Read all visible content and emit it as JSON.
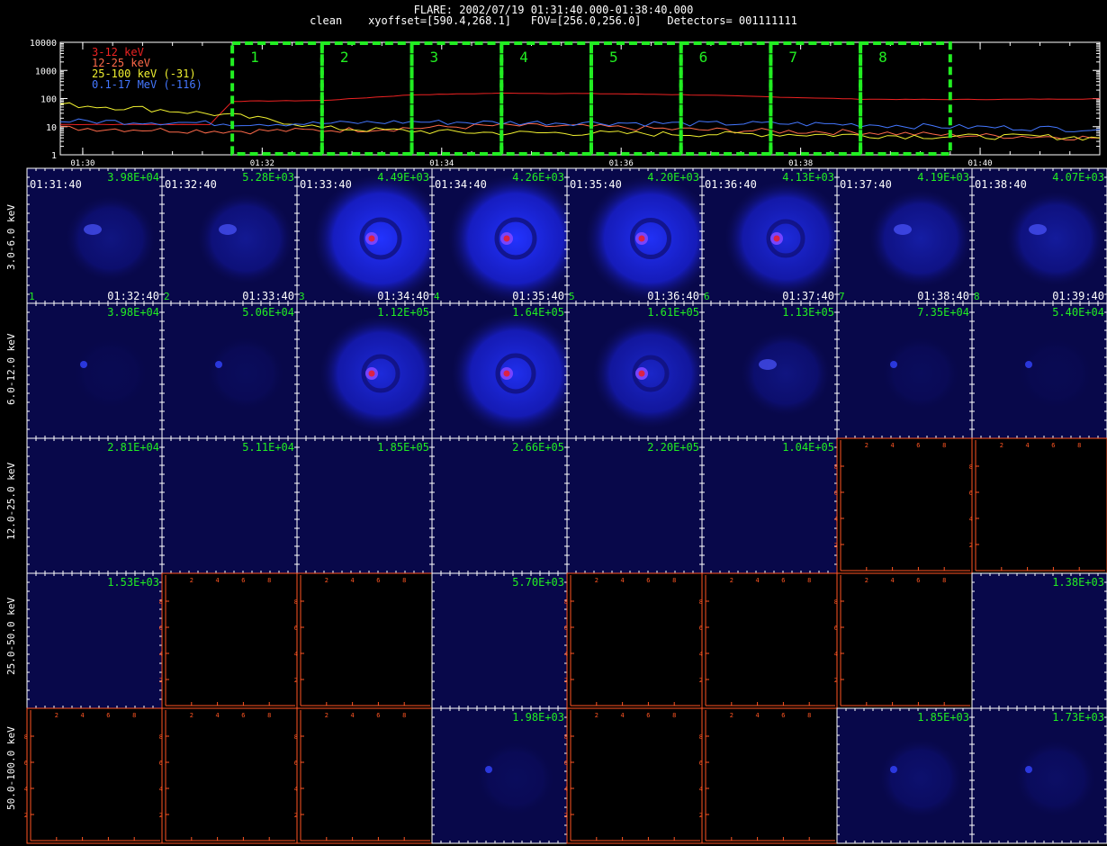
{
  "header": {
    "title": "FLARE: 2002/07/19 01:31:40.000-01:38:40.000",
    "subtitle": "clean    xyoffset=[590.4,268.1]   FOV=[256.0,256.0]    Detectors= 001111111"
  },
  "colors": {
    "background": "#000000",
    "frame": "#ffffff",
    "interval_box": "#22ee22",
    "peak_label": "#22ee22",
    "empty_axis": "#ff5522",
    "image_base": "#08084a"
  },
  "chart_data": [
    {
      "type": "line",
      "ylim": [
        1,
        10000
      ],
      "yscale": "log",
      "yticks": [
        "1",
        "10",
        "100",
        "1000",
        "10000"
      ],
      "xlim_minutes": [
        "01:29:45",
        "01:41:20"
      ],
      "xticks": [
        "01:30",
        "01:32",
        "01:34",
        "01:36",
        "01:38",
        "01:40"
      ],
      "series": [
        {
          "name": "3-12 keV",
          "color": "#ee2222",
          "x": [
            "01:29:45",
            "01:31:00",
            "01:31:25",
            "01:31:40",
            "01:32:40",
            "01:33:40",
            "01:34:40",
            "01:35:40",
            "01:36:40",
            "01:37:40",
            "01:38:40",
            "01:39:40",
            "01:40:40",
            "01:41:20"
          ],
          "values": [
            12,
            12,
            12,
            80,
            85,
            135,
            155,
            150,
            138,
            115,
            95,
            92,
            95,
            98
          ]
        },
        {
          "name": "12-25 keV",
          "color": "#ff6a4a",
          "x": [
            "01:29:45",
            "01:30:40",
            "01:31:40",
            "01:32:40",
            "01:33:40",
            "01:34:40",
            "01:35:40",
            "01:36:40",
            "01:37:40",
            "01:38:40",
            "01:39:40",
            "01:40:40",
            "01:41:20"
          ],
          "values": [
            9,
            8,
            7,
            7.5,
            9,
            11,
            10,
            8,
            7,
            6.5,
            5,
            4.5,
            4
          ]
        },
        {
          "name": "25-100 keV (-31)",
          "color": "#f0f030",
          "x": [
            "01:29:45",
            "01:30:40",
            "01:31:40",
            "01:32:20",
            "01:32:40",
            "01:33:40",
            "01:34:40",
            "01:35:40",
            "01:36:40",
            "01:37:40",
            "01:38:40",
            "01:39:40",
            "01:40:40",
            "01:41:20"
          ],
          "values": [
            62,
            45,
            25,
            14,
            9,
            7,
            6,
            6,
            5.5,
            5.5,
            5,
            4.5,
            4.5,
            4
          ]
        },
        {
          "name": "0.1-17 MeV (-116)",
          "color": "#4477ff",
          "x": [
            "01:29:45",
            "01:30:40",
            "01:31:40",
            "01:32:40",
            "01:33:40",
            "01:34:40",
            "01:35:40",
            "01:36:40",
            "01:37:40",
            "01:38:40",
            "01:39:40",
            "01:40:40",
            "01:41:20"
          ],
          "values": [
            16,
            15,
            13,
            13,
            15,
            14,
            14,
            13,
            13,
            12,
            10,
            9,
            8
          ]
        }
      ],
      "intervals": [
        "1",
        "2",
        "3",
        "4",
        "5",
        "6",
        "7",
        "8"
      ]
    },
    {
      "type": "heatmap",
      "energy_bands": [
        "3.0-6.0 keV",
        "6.0-12.0 keV",
        "12.0-25.0 keV",
        "25.0-50.0 keV",
        "50.0-100.0 keV"
      ],
      "intervals": [
        "1",
        "2",
        "3",
        "4",
        "5",
        "6",
        "7",
        "8"
      ],
      "start_times": [
        "01:31:40",
        "01:32:40",
        "01:33:40",
        "01:34:40",
        "01:35:40",
        "01:36:40",
        "01:37:40",
        "01:38:40"
      ],
      "end_times": [
        "01:32:40",
        "01:33:40",
        "01:34:40",
        "01:35:40",
        "01:36:40",
        "01:37:40",
        "01:38:40",
        "01:39:40"
      ],
      "empty_axis_ticks": [
        "2",
        "4",
        "6",
        "8"
      ],
      "peaks": [
        [
          "3.98E+04",
          "5.28E+03",
          "4.49E+03",
          "4.26E+03",
          "4.20E+03",
          "4.13E+03",
          "4.19E+03",
          "4.07E+03"
        ],
        [
          "3.98E+04",
          "5.06E+04",
          "1.12E+05",
          "1.64E+05",
          "1.61E+05",
          "1.13E+05",
          "7.35E+04",
          "5.40E+04"
        ],
        [
          "2.81E+04",
          "5.11E+04",
          "1.85E+05",
          "2.66E+05",
          "2.20E+05",
          "1.04E+05",
          "",
          ""
        ],
        [
          "1.53E+03",
          "",
          "",
          "5.70E+03",
          "",
          "",
          "",
          "1.38E+03"
        ],
        [
          "",
          "",
          "",
          "1.98E+03",
          "",
          "",
          "1.85E+03",
          "1.73E+03"
        ]
      ],
      "intensity": [
        [
          0.3,
          0.4,
          1.0,
          1.0,
          0.95,
          0.8,
          0.5,
          0.45
        ],
        [
          0.05,
          0.1,
          0.8,
          0.9,
          0.7,
          0.3,
          0.1,
          0.05
        ],
        [
          0,
          0,
          0,
          0,
          0,
          0,
          0,
          0
        ],
        [
          0,
          0,
          0,
          0,
          0,
          0,
          0,
          0
        ],
        [
          0,
          0,
          0,
          0.1,
          0,
          0,
          0.2,
          0.15
        ]
      ]
    }
  ]
}
